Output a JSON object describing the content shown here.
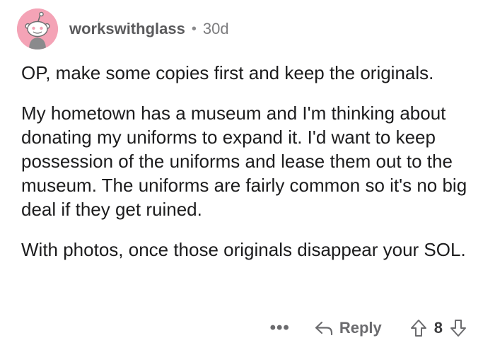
{
  "comment": {
    "author": "workswithglass",
    "separator": "•",
    "age": "30d",
    "paragraphs": [
      "OP, make some copies first and keep the originals.",
      "My hometown has a museum and I'm thinking about donating my uniforms to expand it. I'd want to keep possession of the uniforms and lease them out to the museum. The uniforms are fairly common so it's no big deal if they get ruined.",
      "With photos, once those originals disappear your SOL."
    ],
    "more_label": "•••",
    "reply_label": "Reply",
    "score": "8"
  },
  "icons": {
    "avatar": "reddit-snoo-avatar-icon",
    "reply": "reply-arrow-icon",
    "upvote": "upvote-arrow-icon",
    "downvote": "downvote-arrow-icon"
  },
  "colors": {
    "avatar_bg": "#f4a3b6",
    "muted_text": "#6b6b6e"
  }
}
